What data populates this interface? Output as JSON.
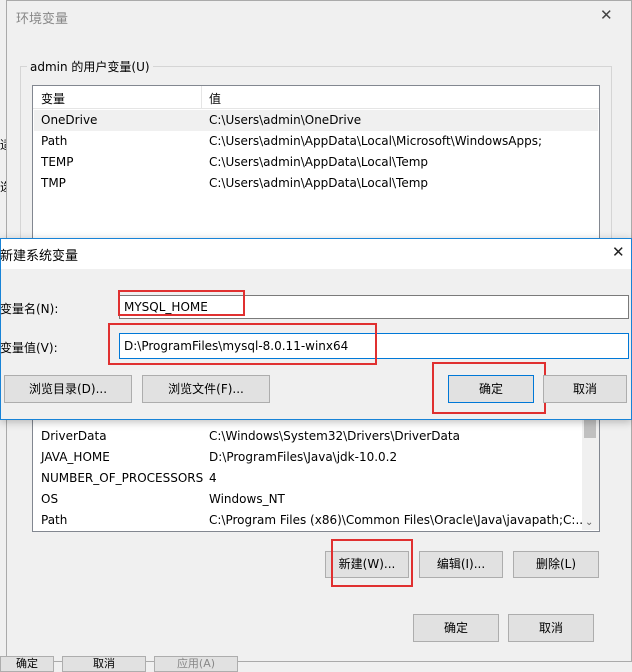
{
  "env_dialog": {
    "title": "环境变量",
    "close_glyph": "✕",
    "user_group_label": "admin 的用户变量(U)",
    "columns": {
      "name": "变量",
      "value": "值"
    },
    "user_vars": [
      {
        "name": "OneDrive",
        "value": "C:\\Users\\admin\\OneDrive"
      },
      {
        "name": "Path",
        "value": "C:\\Users\\admin\\AppData\\Local\\Microsoft\\WindowsApps;"
      },
      {
        "name": "TEMP",
        "value": "C:\\Users\\admin\\AppData\\Local\\Temp"
      },
      {
        "name": "TMP",
        "value": "C:\\Users\\admin\\AppData\\Local\\Temp"
      }
    ],
    "system_vars": [
      {
        "name": "DriverData",
        "value": "C:\\Windows\\System32\\Drivers\\DriverData"
      },
      {
        "name": "JAVA_HOME",
        "value": "D:\\ProgramFiles\\Java\\jdk-10.0.2"
      },
      {
        "name": "NUMBER_OF_PROCESSORS",
        "value": "4"
      },
      {
        "name": "OS",
        "value": "Windows_NT"
      },
      {
        "name": "Path",
        "value": "C:\\Program Files (x86)\\Common Files\\Oracle\\Java\\javapath;C:..."
      }
    ],
    "system_buttons": {
      "new": "新建(W)...",
      "edit": "编辑(I)...",
      "delete": "删除(L)"
    },
    "footer_buttons": {
      "ok": "确定",
      "cancel": "取消"
    }
  },
  "new_var_dialog": {
    "title": "新建系统变量",
    "close_glyph": "✕",
    "name_label": "变量名(N):",
    "name_value": "MYSQL_HOME",
    "value_label": "变量值(V):",
    "value_value": "D:\\ProgramFiles\\mysql-8.0.11-winx64",
    "browse_dir": "浏览目录(D)...",
    "browse_file": "浏览文件(F)...",
    "ok": "确定",
    "cancel": "取消"
  },
  "background_window": {
    "partial_chars": [
      "选",
      "适",
      "量"
    ],
    "partial_buttons": [
      "确定",
      "取消",
      "应用(A)"
    ]
  },
  "colors": {
    "highlight": "#e03030",
    "selected_row": "#f0f0f0",
    "dialog_border": "#1883d7"
  }
}
